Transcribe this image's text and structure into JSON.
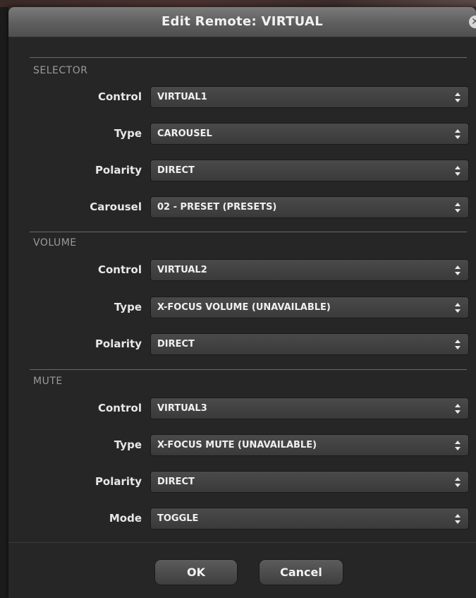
{
  "dialog": {
    "title": "Edit Remote: VIRTUAL",
    "close_icon": "close-icon"
  },
  "sections": {
    "selector": {
      "title": "SELECTOR",
      "rows": [
        {
          "label": "Control",
          "value": "VIRTUAL1"
        },
        {
          "label": "Type",
          "value": "CAROUSEL"
        },
        {
          "label": "Polarity",
          "value": "DIRECT"
        },
        {
          "label": "Carousel",
          "value": "02 - PRESET (PRESETS)"
        }
      ]
    },
    "volume": {
      "title": "VOLUME",
      "rows": [
        {
          "label": "Control",
          "value": "VIRTUAL2"
        },
        {
          "label": "Type",
          "value": "X-FOCUS VOLUME (UNAVAILABLE)"
        },
        {
          "label": "Polarity",
          "value": "DIRECT"
        }
      ]
    },
    "mute": {
      "title": "MUTE",
      "rows": [
        {
          "label": "Control",
          "value": "VIRTUAL3"
        },
        {
          "label": "Type",
          "value": "X-FOCUS MUTE (UNAVAILABLE)"
        },
        {
          "label": "Polarity",
          "value": "DIRECT"
        },
        {
          "label": "Mode",
          "value": "TOGGLE"
        }
      ]
    }
  },
  "buttons": {
    "ok": "OK",
    "cancel": "Cancel"
  }
}
